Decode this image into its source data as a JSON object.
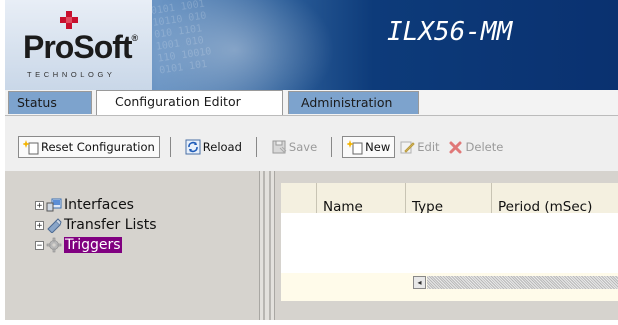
{
  "app": {
    "title": "ILX56-MM",
    "logo_text": "ProSoft",
    "logo_subtext": "TECHNOLOGY",
    "brand_color": "#c8102e",
    "banner_bits": "0101 1001\n10110 010\n010 1101\n1001 010\n110 10010\n0101 101"
  },
  "tabs": [
    {
      "label": "Status",
      "active": false
    },
    {
      "label": "Configuration Editor",
      "active": true
    },
    {
      "label": "Administration",
      "active": false
    }
  ],
  "toolbar": {
    "reset_label": "Reset Configuration",
    "reload_label": "Reload",
    "save_label": "Save",
    "new_label": "New",
    "edit_label": "Edit",
    "delete_label": "Delete"
  },
  "tree": {
    "items": [
      {
        "label": "Interfaces",
        "icon": "interfaces-icon",
        "expander": "+"
      },
      {
        "label": "Transfer Lists",
        "icon": "transfer-lists-icon",
        "expander": "+"
      },
      {
        "label": "Triggers",
        "icon": "triggers-gear-icon",
        "expander": "−",
        "selected": true
      }
    ]
  },
  "table": {
    "columns": [
      "",
      "Name",
      "Type",
      "Period (mSec)"
    ],
    "rows": []
  },
  "colors": {
    "tab_inactive": "#7da3cd",
    "selection": "#800080",
    "panel_bg": "#d6d3ce",
    "list_bg": "#fffbea"
  }
}
